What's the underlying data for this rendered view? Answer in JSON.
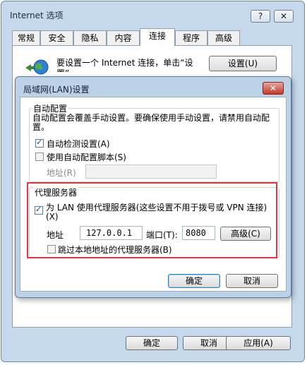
{
  "outer": {
    "title": "Internet 选项",
    "help": "?",
    "close": "✕",
    "tabs": [
      "常规",
      "安全",
      "隐私",
      "内容",
      "连接",
      "程序",
      "高级"
    ],
    "active_tab": "连接",
    "connection_text": "要设置一个 Internet 连接，单击“设置”。",
    "setup_button": "设置(U)",
    "ok": "确定",
    "cancel": "取消",
    "apply": "应用(A)"
  },
  "lan": {
    "title": "局域网(LAN)设置",
    "close": "✕",
    "auto_config": {
      "heading": "自动配置",
      "description": "自动配置会覆盖手动设置。要确保使用手动设置，请禁用自动配置。",
      "auto_detect": {
        "label": "自动检测设置(A)",
        "checked": true
      },
      "use_script": {
        "label": "使用自动配置脚本(S)",
        "checked": false
      },
      "address_label": "地址(R)",
      "address_value": ""
    },
    "proxy": {
      "heading": "代理服务器",
      "use_proxy": {
        "label": "为 LAN 使用代理服务器(这些设置不用于拨号或 VPN 连接)(X)",
        "checked": true
      },
      "address_label": "地址",
      "address_value": "127.0.0.1",
      "port_label": "端口(T):",
      "port_value": "8080",
      "advanced_button": "高级(C)",
      "bypass_local": {
        "label": "跳过本地地址的代理服务器(B)",
        "checked": false
      }
    },
    "ok": "确定",
    "cancel": "取消"
  },
  "colors": {
    "highlight": "#e53545",
    "window_frame": "#c6d9ec"
  }
}
